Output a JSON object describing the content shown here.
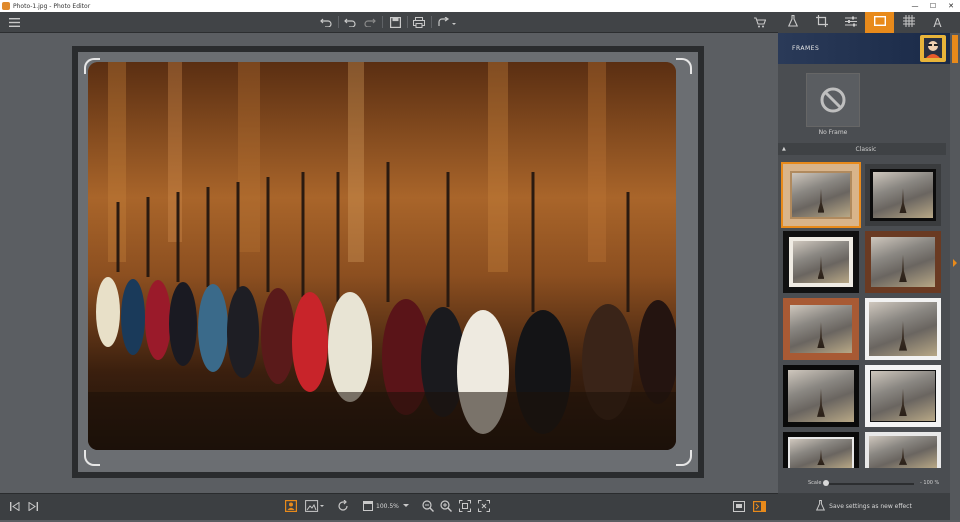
{
  "window": {
    "title": "Photo-1.jpg - Photo Editor",
    "buttons": {
      "minimize": "—",
      "maximize": "☐",
      "close": "✕"
    }
  },
  "toolbar": {
    "icons": [
      "hamburger-icon",
      "undo-icon",
      "redo-icon",
      "redo-alt-icon",
      "save-icon",
      "print-icon",
      "share-icon",
      "cart-icon"
    ]
  },
  "right_tabs": {
    "active": "frames",
    "icons": [
      "flask-icon",
      "crop-icon",
      "adjust-icon",
      "frame-icon",
      "texture-icon",
      "text-icon"
    ],
    "text_tab_label": "A"
  },
  "panel": {
    "header_title": "FRAMES",
    "no_frame_label": "No Frame",
    "section_label": "Classic",
    "scale_label": "Scale",
    "scale_value": "- 100 %",
    "scale_percent": 0,
    "save_label": "Save settings as new effect"
  },
  "bottombar": {
    "zoom_value": "100.5%"
  },
  "colors": {
    "accent": "#e88a1b",
    "toolbar_bg": "#414447",
    "canvas_bg": "#5b5e62"
  }
}
